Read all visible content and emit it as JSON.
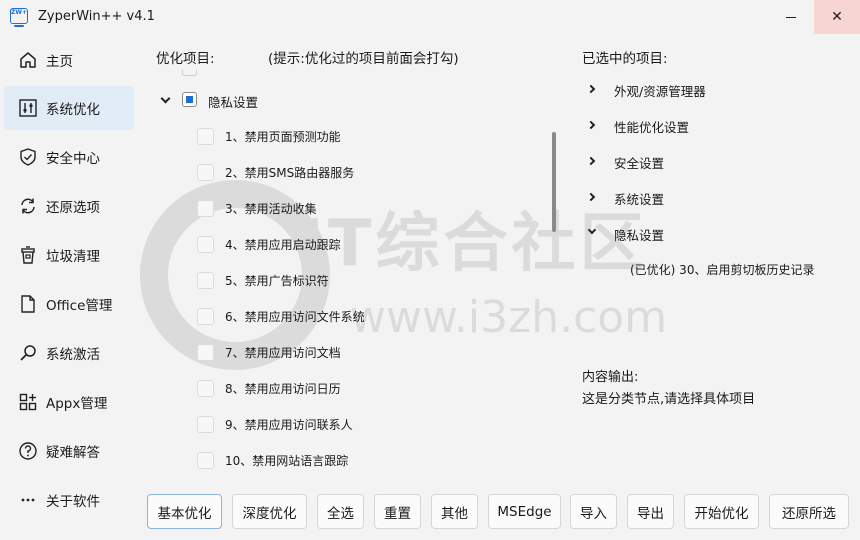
{
  "window": {
    "icon_text": "ZW+",
    "title": "ZyperWin++ v4.1",
    "minimize": "—",
    "close": "✕"
  },
  "sidebar": {
    "items": [
      {
        "label": "主页",
        "icon": "home-icon"
      },
      {
        "label": "系统优化",
        "icon": "sliders-icon",
        "active": true
      },
      {
        "label": "安全中心",
        "icon": "shield-icon"
      },
      {
        "label": "还原选项",
        "icon": "restore-icon"
      },
      {
        "label": "垃圾清理",
        "icon": "trash-icon"
      },
      {
        "label": "Office管理",
        "icon": "document-icon"
      },
      {
        "label": "系统激活",
        "icon": "key-icon"
      },
      {
        "label": "Appx管理",
        "icon": "apps-icon"
      },
      {
        "label": "疑难解答",
        "icon": "help-icon"
      },
      {
        "label": "关于软件",
        "icon": "more-icon"
      }
    ]
  },
  "options": {
    "header": "优化项目:",
    "hint": "(提示:优化过的项目前面会打勾)",
    "group_label": "隐私设置",
    "items": [
      "1、禁用页面预测功能",
      "2、禁用SMS路由器服务",
      "3、禁用活动收集",
      "4、禁用应用启动跟踪",
      "5、禁用广告标识符",
      "6、禁用应用访问文件系统",
      "7、禁用应用访问文档",
      "8、禁用应用访问日历",
      "9、禁用应用访问联系人",
      "10、禁用网站语言跟踪"
    ]
  },
  "selected": {
    "header": "已选中的项目:",
    "groups": [
      "外观/资源管理器",
      "性能优化设置",
      "安全设置",
      "系统设置",
      "隐私设置"
    ],
    "child": "(已优化) 30、启用剪切板历史记录"
  },
  "output": {
    "label": "内容输出:",
    "text": "这是分类节点,请选择具体项目"
  },
  "watermark": {
    "main": "IT综合社区",
    "url": "www.i3zh.com"
  },
  "buttons": [
    "基本优化",
    "深度优化",
    "全选",
    "重置",
    "其他",
    "MSEdge",
    "导入",
    "导出",
    "开始优化",
    "还原所选"
  ],
  "colors": {
    "accent": "#1c6fd5",
    "active_nav": "#e2ecf6",
    "close_hover": "#f6d5d3"
  }
}
